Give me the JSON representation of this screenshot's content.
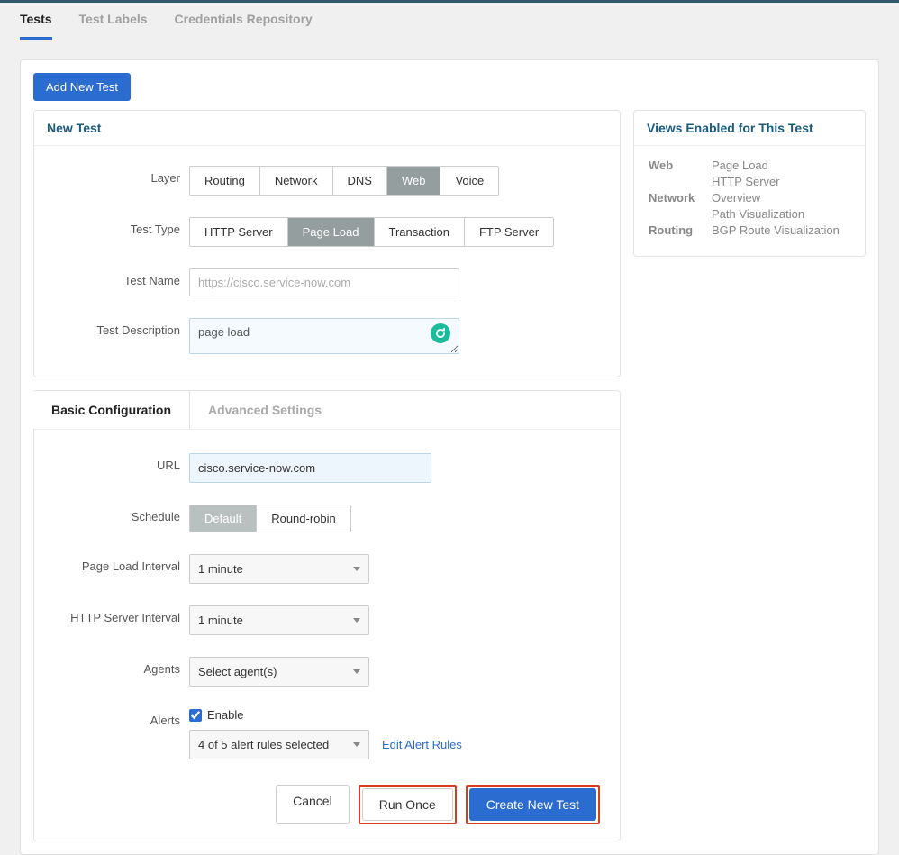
{
  "topTabs": [
    {
      "label": "Tests",
      "active": true
    },
    {
      "label": "Test Labels",
      "active": false
    },
    {
      "label": "Credentials Repository",
      "active": false
    }
  ],
  "addButton": "Add New Test",
  "newTest": {
    "title": "New Test",
    "layerLabel": "Layer",
    "layerOptions": [
      "Routing",
      "Network",
      "DNS",
      "Web",
      "Voice"
    ],
    "layerActive": "Web",
    "testTypeLabel": "Test Type",
    "testTypeOptions": [
      "HTTP Server",
      "Page Load",
      "Transaction",
      "FTP Server"
    ],
    "testTypeActive": "Page Load",
    "testNameLabel": "Test Name",
    "testNamePlaceholder": "https://cisco.service-now.com",
    "testDescLabel": "Test Description",
    "testDescValue": "page load"
  },
  "configTabs": {
    "basic": "Basic Configuration",
    "advanced": "Advanced Settings"
  },
  "config": {
    "urlLabel": "URL",
    "urlValue": "cisco.service-now.com",
    "scheduleLabel": "Schedule",
    "scheduleOptions": [
      "Default",
      "Round-robin"
    ],
    "scheduleActive": "Default",
    "pageLoadLabel": "Page Load Interval",
    "pageLoadValue": "1 minute",
    "httpLabel": "HTTP Server Interval",
    "httpValue": "1 minute",
    "agentsLabel": "Agents",
    "agentsValue": "Select agent(s)",
    "alertsLabel": "Alerts",
    "alertsEnable": "Enable",
    "alertsRules": "4 of 5 alert rules selected",
    "editAlertRules": "Edit Alert Rules"
  },
  "actions": {
    "cancel": "Cancel",
    "runOnce": "Run Once",
    "create": "Create New Test"
  },
  "views": {
    "title": "Views Enabled for This Test",
    "groups": [
      {
        "category": "Web",
        "items": [
          "Page Load",
          "HTTP Server"
        ]
      },
      {
        "category": "Network",
        "items": [
          "Overview",
          "Path Visualization"
        ]
      },
      {
        "category": "Routing",
        "items": [
          "BGP Route Visualization"
        ]
      }
    ]
  }
}
